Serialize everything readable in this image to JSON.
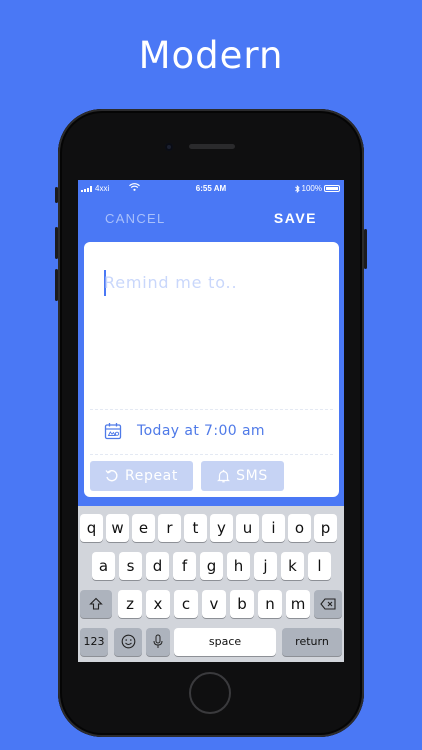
{
  "headline": "Modern",
  "status_bar": {
    "carrier": "4xxi",
    "time": "6:55 AM",
    "battery": "100%"
  },
  "nav": {
    "cancel": "CANCEL",
    "save": "SAVE"
  },
  "reminder": {
    "placeholder": "Remind me to.."
  },
  "due": {
    "label": "Today at 7:00 am"
  },
  "options": {
    "repeat": "Repeat",
    "sms": "SMS"
  },
  "keyboard": {
    "row1": [
      "q",
      "w",
      "e",
      "r",
      "t",
      "y",
      "u",
      "i",
      "o",
      "p"
    ],
    "row2": [
      "a",
      "s",
      "d",
      "f",
      "g",
      "h",
      "j",
      "k",
      "l"
    ],
    "row3": [
      "z",
      "x",
      "c",
      "v",
      "b",
      "n",
      "m"
    ],
    "numbers_key": "123",
    "space_key": "space",
    "return_key": "return"
  },
  "colors": {
    "background": "#4a78f5",
    "accent": "#4f7ae8",
    "pill": "#c6d3f4"
  }
}
